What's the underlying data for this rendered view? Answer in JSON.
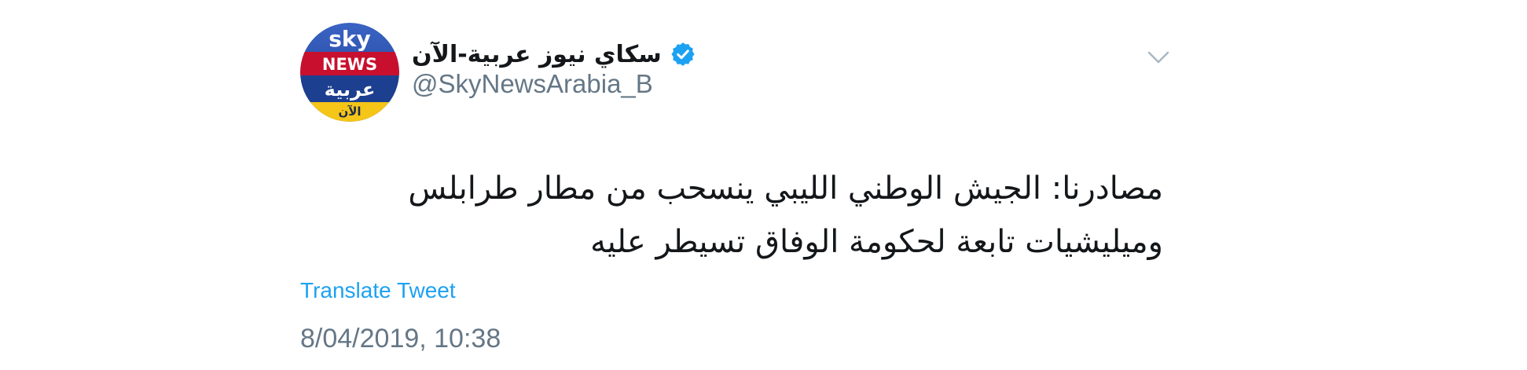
{
  "tweet": {
    "author": {
      "display_name": "سكاي نيوز عربية-الآن",
      "handle": "@SkyNewsArabia_B",
      "verified": true,
      "avatar": {
        "line1": "sky",
        "line2": "NEWS",
        "line3": "عربية",
        "line4": "الآن",
        "colors": {
          "top": "#2a4fa8",
          "band": "#c8102e",
          "bottom": "#1d3f8f",
          "strip": "#f5c518"
        }
      }
    },
    "text_lines": [
      "مصادرنا: الجيش الوطني الليبي ينسحب من مطار طرابلس",
      "وميليشيات تابعة لحكومة الوفاق تسيطر عليه"
    ],
    "translate_label": "Translate Tweet",
    "timestamp": "8/04/2019, 10:38",
    "menu_icon": "chevron-down-icon",
    "verified_icon": "verified-badge-icon",
    "colors": {
      "link": "#1da1f2",
      "secondary": "#657786",
      "primary_text": "#14171a",
      "verified": "#1da1f2"
    }
  }
}
